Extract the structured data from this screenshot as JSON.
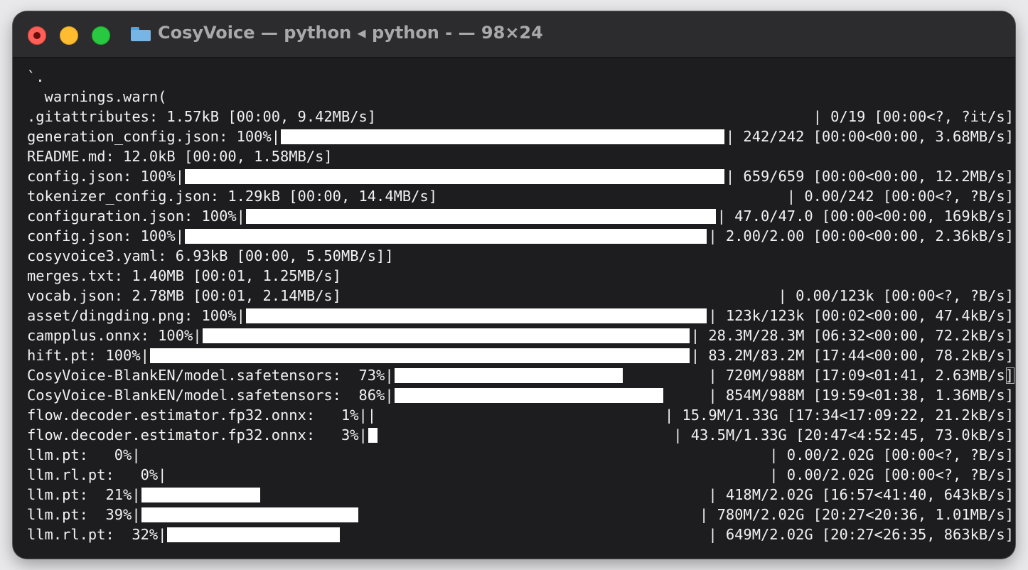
{
  "window": {
    "title": "CosyVoice — python ◂ python - — 98×24",
    "folder_icon": "folder-icon",
    "traffic_lights": {
      "close": "#fe5f57",
      "minimize": "#febc2e",
      "zoom": "#28c840"
    }
  },
  "terminal": {
    "background": "#1d1d1f",
    "lines": [
      {
        "text": "`."
      },
      {
        "text": "  warnings.warn("
      },
      {
        "text": ".gitattributes: 1.57kB [00:00, 9.42MB/s]"
      },
      {
        "text": "generation_config.json: 100%|"
      },
      {
        "text": "README.md: 12.0kB [00:00, 1.58MB/s]"
      },
      {
        "text": "config.json: 100%|"
      },
      {
        "text": "tokenizer_config.json: 1.29kB [00:00, 14.4MB/s]"
      },
      {
        "text": "configuration.json: 100%|"
      },
      {
        "text": "config.json: 100%|"
      },
      {
        "text": "cosyvoice3.yaml: 6.93kB [00:00, 5.50MB/s]]"
      },
      {
        "text": "merges.txt: 1.40MB [00:01, 1.25MB/s]"
      },
      {
        "text": "vocab.json: 2.78MB [00:01, 2.14MB/s]"
      },
      {
        "text": "asset/dingding.png: 100%|"
      },
      {
        "text": "campplus.onnx: 100%|"
      },
      {
        "text": "hift.pt: 100%|"
      },
      {
        "text": "CosyVoice-BlankEN/model.safetensors:  73%|"
      },
      {
        "text": "CosyVoice-BlankEN/model.safetensors:  86%|"
      },
      {
        "text": "flow.decoder.estimator.fp32.onnx:   1%||"
      },
      {
        "text": "flow.decoder.estimator.fp32.onnx:   3%|"
      },
      {
        "text": "llm.pt:   0%|"
      },
      {
        "text": "llm.rl.pt:   0%|"
      },
      {
        "text": "llm.pt:  21%|"
      },
      {
        "text": "llm.pt:  39%|"
      },
      {
        "text": "llm.rl.pt:  32%|"
      }
    ],
    "progress": [
      {
        "line": 2,
        "fill": 0,
        "stats": "| 0/19 [00:00<?, ?it/s]"
      },
      {
        "line": 3,
        "fill": 1.0,
        "stats": "| 242/242 [00:00<00:00, 3.68MB/s]"
      },
      {
        "line": 5,
        "fill": 1.0,
        "stats": "| 659/659 [00:00<00:00, 12.2MB/s]"
      },
      {
        "line": 6,
        "fill": 0,
        "stats": "| 0.00/242 [00:00<?, ?B/s]"
      },
      {
        "line": 7,
        "fill": 1.0,
        "stats": "| 47.0/47.0 [00:00<00:00, 169kB/s]"
      },
      {
        "line": 8,
        "fill": 1.0,
        "stats": "| 2.00/2.00 [00:00<00:00, 2.36kB/s]"
      },
      {
        "line": 11,
        "fill": 0,
        "stats": "| 0.00/123k [00:00<?, ?B/s]"
      },
      {
        "line": 12,
        "fill": 1.0,
        "stats": "| 123k/123k [00:02<00:00, 47.4kB/s]"
      },
      {
        "line": 13,
        "fill": 1.0,
        "stats": "| 28.3M/28.3M [06:32<00:00, 72.2kB/s]"
      },
      {
        "line": 14,
        "fill": 1.0,
        "stats": "| 83.2M/83.2M [17:44<00:00, 78.2kB/s]"
      },
      {
        "line": 15,
        "fill": 0.73,
        "stats": "| 720M/988M [17:09<01:41, 2.63MB/s]",
        "cursor": true
      },
      {
        "line": 16,
        "fill": 0.86,
        "stats": "| 854M/988M [19:59<01:38, 1.36MB/s]"
      },
      {
        "line": 17,
        "fill": 0,
        "stats": "| 15.9M/1.33G [17:34<17:09:22, 21.2kB/s]"
      },
      {
        "line": 18,
        "fill": 0.03,
        "stats": "| 43.5M/1.33G [20:47<4:52:45, 73.0kB/s]"
      },
      {
        "line": 19,
        "fill": 0,
        "stats": "| 0.00/2.02G [00:00<?, ?B/s]"
      },
      {
        "line": 20,
        "fill": 0,
        "stats": "| 0.00/2.02G [00:00<?, ?B/s]"
      },
      {
        "line": 21,
        "fill": 0.21,
        "stats": "| 418M/2.02G [16:57<41:40, 643kB/s]"
      },
      {
        "line": 22,
        "fill": 0.39,
        "stats": "| 780M/2.02G [20:27<20:36, 1.01MB/s]"
      },
      {
        "line": 23,
        "fill": 0.32,
        "stats": "| 649M/2.02G [20:27<26:35, 863kB/s]"
      }
    ]
  }
}
